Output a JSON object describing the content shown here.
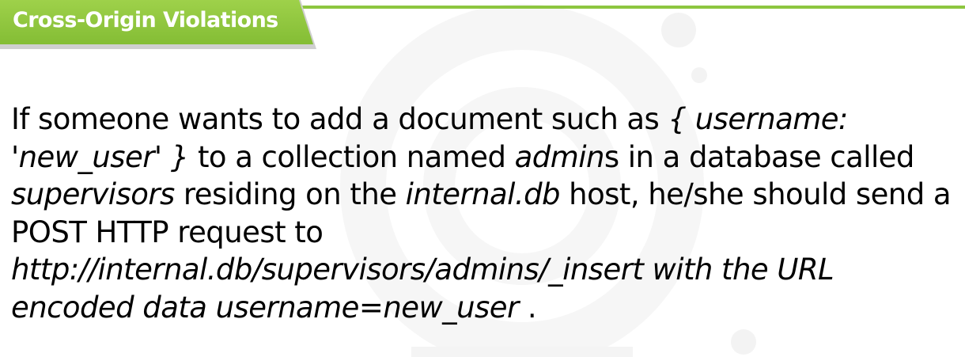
{
  "slide": {
    "title": "Cross-Origin Violations",
    "lines": [
      [
        {
          "text": "If someone wants to add a document such as ",
          "italic": false
        },
        {
          "text": "{ username:",
          "italic": true
        }
      ],
      [
        {
          "text": "'new_user' }",
          "italic": true
        },
        {
          "text": " to a collection named ",
          "italic": false
        },
        {
          "text": "admin",
          "italic": true
        },
        {
          "text": "s in a database called",
          "italic": false
        }
      ],
      [
        {
          "text": "supervisors",
          "italic": true
        },
        {
          "text": " residing on the ",
          "italic": false
        },
        {
          "text": "internal.db",
          "italic": true
        },
        {
          "text": " host, he/she should send a",
          "italic": false
        }
      ],
      [
        {
          "text": "POST HTTP request to",
          "italic": false
        }
      ],
      [
        {
          "text": "http://internal.db/supervisors/admins/_insert with the URL",
          "italic": true
        }
      ],
      [
        {
          "text": "encoded data username=new_user",
          "italic": true
        },
        {
          "text": " .",
          "italic": false
        }
      ]
    ]
  },
  "colors": {
    "accent": "#8dc63f",
    "title_text": "#ffffff",
    "body_text": "#000000"
  }
}
